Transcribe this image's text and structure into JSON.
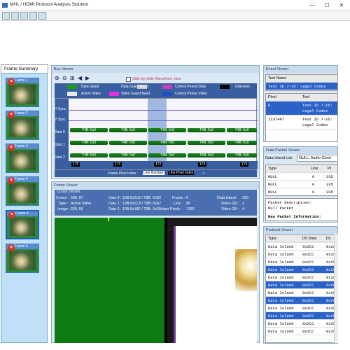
{
  "app": {
    "title": "MHL / HDMI Protocol Analysis Solution",
    "minimize": "—",
    "maximize": "☐",
    "close": "✕"
  },
  "frame_summary": {
    "tab": "Frame Summary",
    "frames": [
      "Frame 1",
      "Frame 2",
      "Frame 3",
      "Frame 4",
      "Frame 5",
      "Frame 6"
    ],
    "selected_index": 4
  },
  "bus_viewer": {
    "title": "Bus Viewer",
    "side_by_side": "Side by Side Waveform view",
    "legend": [
      {
        "label": "Data Island",
        "color": "#1a9e1a"
      },
      {
        "label": "Data Guard Band",
        "color": "#c8c8c8"
      },
      {
        "label": "Control Period Data",
        "color": "#c040c0"
      },
      {
        "label": "Unknown",
        "color": "#000000"
      },
      {
        "label": "Active Video",
        "color": "#e8e8e8"
      },
      {
        "label": "Video Guard Band",
        "color": "#e030e0"
      },
      {
        "label": "Control Period Video",
        "color": "#2050c0"
      }
    ],
    "rows": [
      "H Sync",
      "V Sync",
      "Data 0",
      "Data 1",
      "Data 2"
    ],
    "bar_text": "T4B: 0x0",
    "pixels": [
      "170",
      "171",
      "172",
      "174",
      "175"
    ],
    "footer_left": "Frame Pixel Index :",
    "footer_mid": "Line Number",
    "footer_right": "Line Pixel Index",
    "footer_arrow": "->"
  },
  "frame_viewer": {
    "title": "Frame Viewer",
    "cursor_details": "Cursor Details",
    "c1": [
      [
        "Cursor :",
        "590, 87"
      ],
      [
        "Type :",
        "Active Video"
      ],
      [
        "Image :",
        "220, 56"
      ]
    ],
    "c2": [
      [
        "Data 0 :",
        "10B:0x21B / T8B: 0xD2"
      ],
      [
        "Data 1 :",
        "10B:0x1C8 / T8B: 0xA7"
      ],
      [
        "Data 2 :",
        "10B:0x18E / T8B: 0x20"
      ]
    ],
    "c3": [
      [
        "Frame :",
        "0"
      ],
      [
        "Line :",
        "86"
      ],
      [
        "Video Pixels :",
        "1280"
      ]
    ],
    "c4": [
      [
        "Data Island :",
        "320"
      ],
      [
        "Video GB :",
        "2"
      ],
      [
        "Video GB :",
        "4"
      ]
    ]
  },
  "event_viewer": {
    "title": "Event Viewer",
    "col_test": "Test Name",
    "row1": "Test ID 7-16: Legal Codes",
    "col_pixel": "Pixel",
    "col_test2": "Test",
    "rows": [
      {
        "pixel": "0",
        "test": "Test ID 7-16: Legal Codes"
      },
      {
        "pixel": "1237497",
        "test": "Test ID 7-16: Legal Codes"
      }
    ]
  },
  "packet_viewer": {
    "title": "Data Packet Viewer",
    "list_label": "Data Island List:",
    "list_value": "NULL, Audio Clock",
    "cols": [
      "Type",
      "Line",
      "Pi"
    ],
    "rows": [
      [
        "NULL",
        "0",
        "335"
      ],
      [
        "NULL",
        "0",
        "335"
      ],
      [
        "NULL",
        "0",
        "335"
      ]
    ],
    "desc_label": "Packet description:",
    "desc_value": "Null Packet",
    "raw_label": "Raw Packet Information:"
  },
  "protocol_viewer": {
    "title": "Protocol Viewer",
    "cols": [
      "Type",
      "D0 Data",
      "D1"
    ],
    "rows": [
      [
        "Data Island",
        "0x2CC",
        "0x29"
      ],
      [
        "Data Island",
        "0x2CC",
        "0x29"
      ],
      [
        "Data Island",
        "0x2CC",
        "0x29"
      ],
      [
        "Data Island",
        "0x2CC",
        "0x29"
      ],
      [
        "Data Island",
        "0x2CC",
        "0x29"
      ],
      [
        "Data Island",
        "0x2CC",
        "0x29"
      ],
      [
        "Data Island",
        "0x2CC",
        "0x29"
      ],
      [
        "Data Island",
        "0x2CC",
        "0x29"
      ],
      [
        "Data Island",
        "0x2CC",
        "0x29"
      ],
      [
        "Data Island",
        "0x2CC",
        "0x29"
      ],
      [
        "Data Island",
        "0x2CC",
        "0x29"
      ],
      [
        "Data Island",
        "0x2CC",
        "0x29"
      ]
    ],
    "highlight_rows": [
      3,
      5,
      7,
      9
    ]
  }
}
